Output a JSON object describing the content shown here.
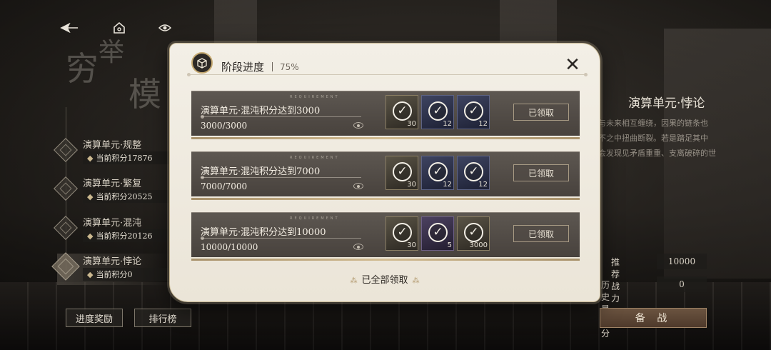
{
  "top_bar": {
    "back_icon": "back-arrow-icon",
    "home_icon": "home-icon",
    "help_icon": "help-icon"
  },
  "left_panel": {
    "title_chars": [
      "穷",
      "举",
      "模"
    ],
    "units": [
      {
        "name": "演算单元·规整",
        "score_label": "当前积分17876"
      },
      {
        "name": "演算单元·繁复",
        "score_label": "当前积分20525"
      },
      {
        "name": "演算单元·混沌",
        "score_label": "当前积分20126"
      },
      {
        "name": "演算单元·悖论",
        "score_label": "当前积分0"
      }
    ],
    "progress_reward_label": "进度奖励",
    "ranking_label": "排行榜"
  },
  "right_panel": {
    "title": "演算单元·悖论",
    "desc_lines": [
      "与未来相互缠绕，因果的链条也",
      "不之中扭曲断裂。若是踏足其中",
      "会发现见矛盾重重、支离破碎的世"
    ],
    "recommended_power_label": "推荐战力",
    "recommended_power_value": "10000",
    "best_score_label": "历史最高分",
    "best_score_value": "0",
    "battle_label": "备 战"
  },
  "modal": {
    "title": "阶段进度",
    "percent": "75%",
    "close_icon": "close-icon",
    "requirement_en": "REQUIREMENT",
    "tasks": [
      {
        "title": "演算单元·混沌积分达到3000",
        "progress": "3000/3000",
        "button": "已领取",
        "rewards": [
          {
            "qty": "30",
            "style": "r-gold"
          },
          {
            "qty": "12",
            "style": "r-blue"
          },
          {
            "qty": "12",
            "style": "r-blue"
          }
        ]
      },
      {
        "title": "演算单元·混沌积分达到7000",
        "progress": "7000/7000",
        "button": "已领取",
        "rewards": [
          {
            "qty": "30",
            "style": "r-gold"
          },
          {
            "qty": "12",
            "style": "r-blue"
          },
          {
            "qty": "12",
            "style": "r-blue"
          }
        ]
      },
      {
        "title": "演算单元·混沌积分达到10000",
        "progress": "10000/10000",
        "button": "已领取",
        "rewards": [
          {
            "qty": "30",
            "style": "r-gold"
          },
          {
            "qty": "5",
            "style": "r-purple"
          },
          {
            "qty": "3000",
            "style": "r-gold"
          }
        ]
      }
    ],
    "all_claimed": "已全部领取"
  },
  "colors": {
    "modal_bg": "#f3efe6",
    "task_bg": "#5d5751",
    "accent_gold": "#c6aa72",
    "battle_btn": "#6b5440"
  }
}
